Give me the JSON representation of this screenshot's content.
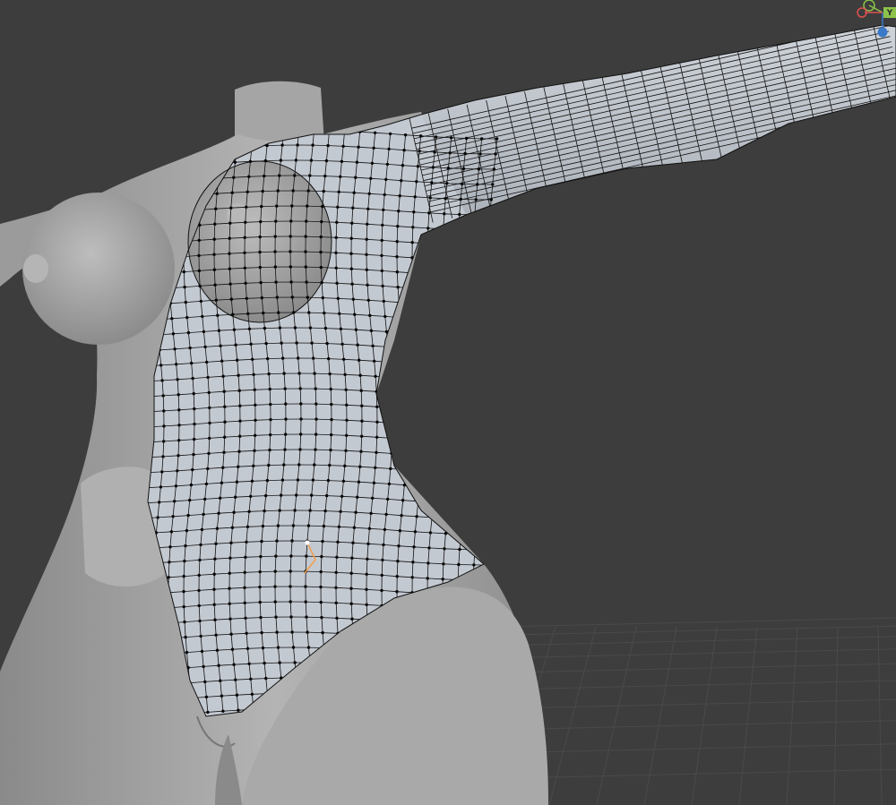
{
  "app": {
    "name": "3D viewport"
  },
  "viewport": {
    "mode": "edit-mode-retopology",
    "background_color": "#3d3d3d",
    "grid_color": "#4a4a4a"
  },
  "model": {
    "base_mesh_color": "#a9a9a9",
    "retopo_mesh_color": "#c4cad2",
    "wire_color": "#111111",
    "vertex_color": "#050505",
    "active_vertex_color": "#ffffff",
    "selected_edge_color": "#f0a050"
  },
  "navigation_gizmo": {
    "axes": [
      {
        "label": "Y",
        "color": "#8bc34a",
        "icon": "y-axis-icon"
      },
      {
        "label": "",
        "color": "#e05050",
        "icon": "x-axis-icon"
      },
      {
        "label": "",
        "color": "#3a78c8",
        "icon": "z-axis-icon"
      }
    ]
  }
}
